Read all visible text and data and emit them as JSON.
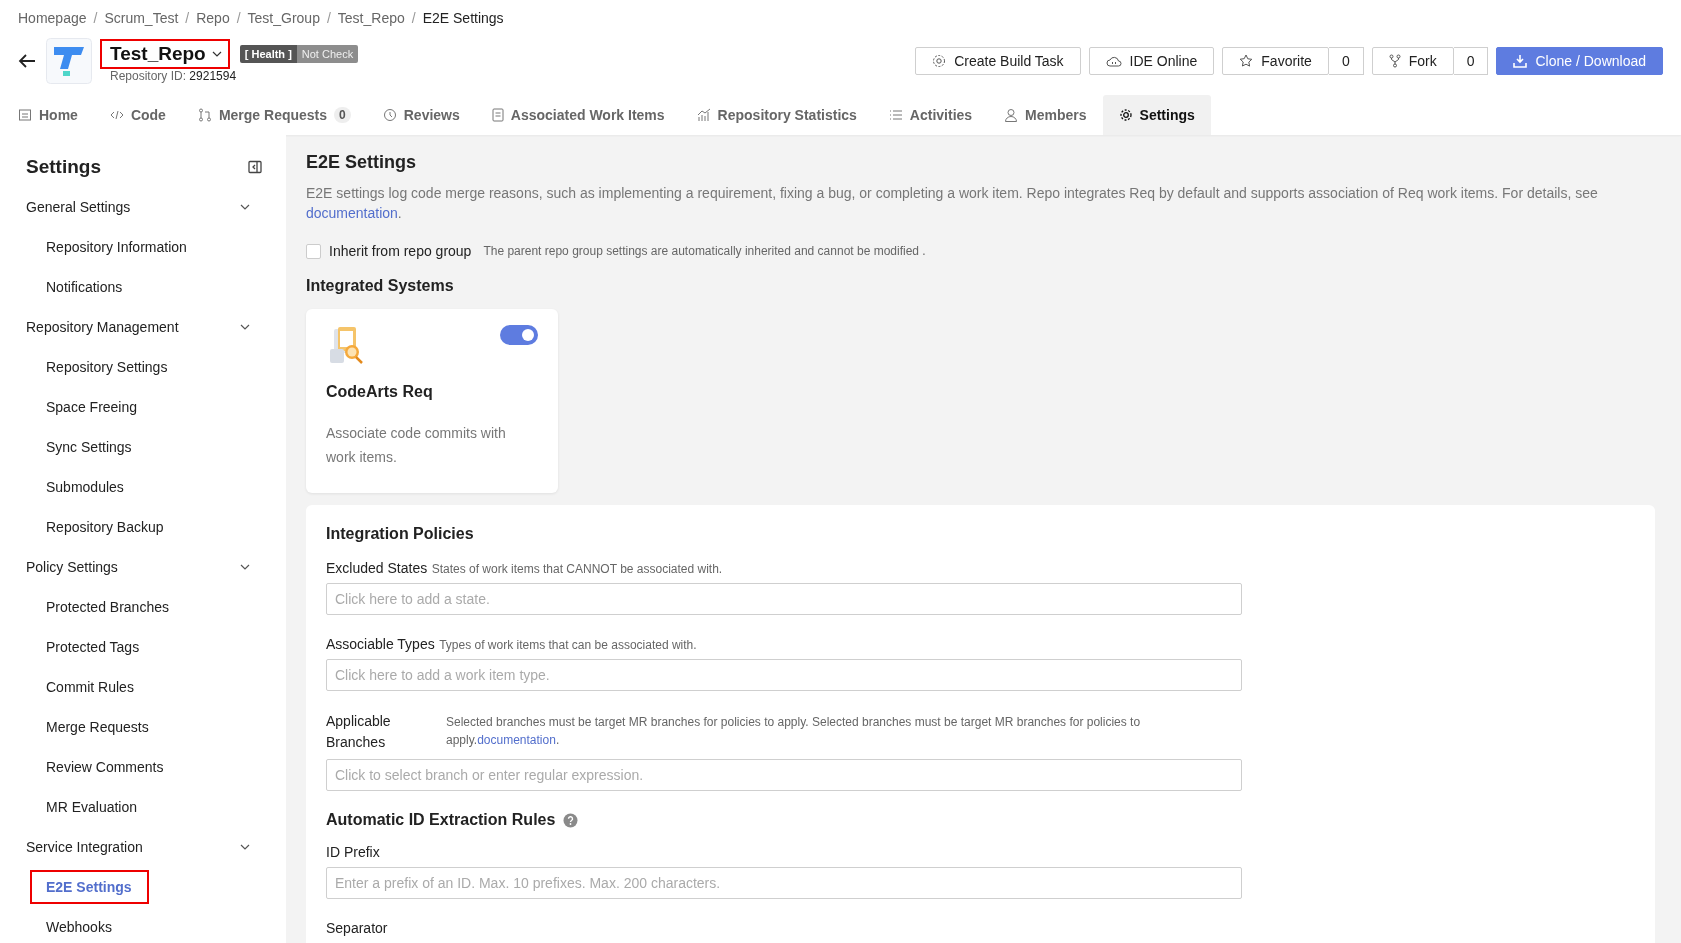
{
  "breadcrumb_separator": "/",
  "breadcrumb": [
    {
      "label": "Homepage",
      "current": false
    },
    {
      "label": "Scrum_Test",
      "current": false
    },
    {
      "label": "Repo",
      "current": false
    },
    {
      "label": "Test_Group",
      "current": false
    },
    {
      "label": "Test_Repo",
      "current": false
    },
    {
      "label": "E2E Settings",
      "current": true
    }
  ],
  "repo": {
    "name": "Test_Repo",
    "highlighted": true,
    "health_label": "[ Health ]",
    "health_status": "Not Check",
    "id_label": "Repository ID:",
    "id": "2921594"
  },
  "actions": [
    {
      "kind": "build",
      "label": "Create Build Task"
    },
    {
      "kind": "ide",
      "label": "IDE Online"
    },
    {
      "kind": "favorite",
      "label": "Favorite",
      "count": "0"
    },
    {
      "kind": "fork",
      "label": "Fork",
      "count": "0"
    },
    {
      "kind": "clone",
      "label": "Clone / Download"
    }
  ],
  "tabs": [
    {
      "kind": "home",
      "label": "Home",
      "selected": false
    },
    {
      "kind": "code",
      "label": "Code",
      "selected": false
    },
    {
      "kind": "merge",
      "label": "Merge Requests",
      "count": "0",
      "selected": false
    },
    {
      "kind": "reviews",
      "label": "Reviews",
      "selected": false
    },
    {
      "kind": "workitems",
      "label": "Associated Work Items",
      "selected": false
    },
    {
      "kind": "stats",
      "label": "Repository Statistics",
      "selected": false
    },
    {
      "kind": "activities",
      "label": "Activities",
      "selected": false
    },
    {
      "kind": "members",
      "label": "Members",
      "selected": false
    },
    {
      "kind": "settings",
      "label": "Settings",
      "selected": true
    }
  ],
  "sidebar": {
    "title": "Settings",
    "groups": [
      {
        "label": "General Settings",
        "expanded": true,
        "children": [
          {
            "label": "Repository Information",
            "selected": false,
            "highlighted": false
          },
          {
            "label": "Notifications",
            "selected": false,
            "highlighted": false
          }
        ]
      },
      {
        "label": "Repository Management",
        "expanded": true,
        "children": [
          {
            "label": "Repository Settings",
            "selected": false,
            "highlighted": false
          },
          {
            "label": "Space Freeing",
            "selected": false,
            "highlighted": false
          },
          {
            "label": "Sync Settings",
            "selected": false,
            "highlighted": false
          },
          {
            "label": "Submodules",
            "selected": false,
            "highlighted": false
          },
          {
            "label": "Repository Backup",
            "selected": false,
            "highlighted": false
          }
        ]
      },
      {
        "label": "Policy Settings",
        "expanded": true,
        "children": [
          {
            "label": "Protected Branches",
            "selected": false,
            "highlighted": false
          },
          {
            "label": "Protected Tags",
            "selected": false,
            "highlighted": false
          },
          {
            "label": "Commit Rules",
            "selected": false,
            "highlighted": false
          },
          {
            "label": "Merge Requests",
            "selected": false,
            "highlighted": false
          },
          {
            "label": "Review Comments",
            "selected": false,
            "highlighted": false
          },
          {
            "label": "MR Evaluation",
            "selected": false,
            "highlighted": false
          }
        ]
      },
      {
        "label": "Service Integration",
        "expanded": true,
        "children": [
          {
            "label": "E2E Settings",
            "selected": true,
            "highlighted": true
          },
          {
            "label": "Webhooks",
            "selected": false,
            "highlighted": false
          }
        ]
      }
    ]
  },
  "main": {
    "title": "E2E Settings",
    "description": {
      "text": "E2E settings log code merge reasons, such as implementing a requirement, fixing a bug, or completing a work item. Repo integrates Req by default and supports association of Req work items. For details, see",
      "link": "documentation",
      "suffix": "."
    },
    "inherit": {
      "label": "Inherit from repo group",
      "checked": false,
      "note": "The parent repo group settings are automatically inherited and cannot be modified ."
    },
    "systems_title": "Integrated Systems",
    "systems": [
      {
        "name": "CodeArts Req",
        "description": "Associate code commits with work items.",
        "on": true
      }
    ],
    "policies": {
      "title": "Integration Policies",
      "fields": [
        {
          "kind": "inline",
          "label": "Excluded States",
          "hint": "States of work items that CANNOT be associated with.",
          "placeholder": "Click here to add a state."
        },
        {
          "kind": "inline",
          "label": "Associable Types",
          "hint": "Types of work items that can be associated with.",
          "placeholder": "Click here to add a work item type."
        },
        {
          "kind": "column",
          "label": "Applicable Branches",
          "hint": "Selected branches must be target MR branches for policies to apply. Selected branches must be target MR branches for policies to apply.",
          "link": "documentation",
          "suffix": ".",
          "placeholder": "Click to select branch or enter regular expression."
        }
      ]
    },
    "id_rules": {
      "title": "Automatic ID Extraction Rules",
      "fields": [
        {
          "label": "ID Prefix",
          "placeholder": "Enter a prefix of an ID. Max. 10 prefixes. Max. 200 characters."
        },
        {
          "label": "Separator"
        }
      ]
    }
  }
}
